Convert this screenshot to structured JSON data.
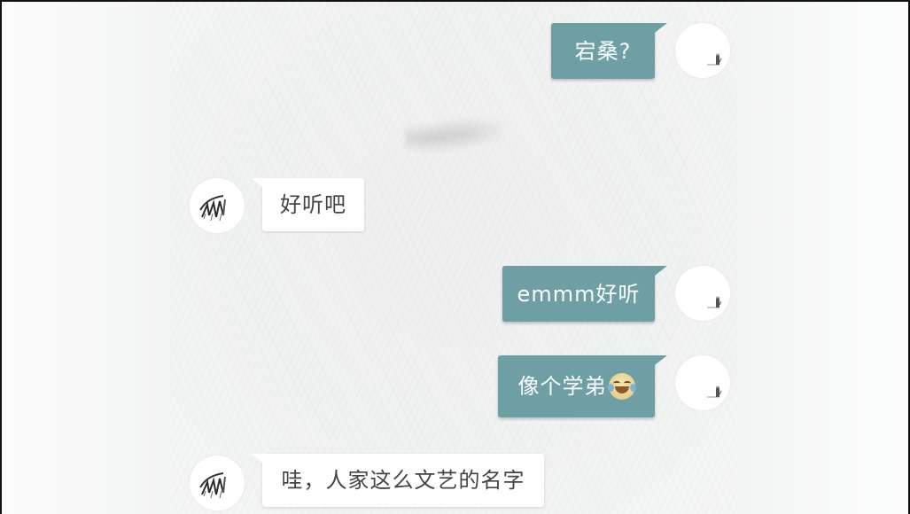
{
  "messages": [
    {
      "sender": "me",
      "text": "宕桑?"
    },
    {
      "sender": "other",
      "text": "好听吧"
    },
    {
      "sender": "me",
      "text": "emmm好听"
    },
    {
      "sender": "me",
      "text": "像个学弟",
      "emoji": "tears-of-joy-emoji"
    },
    {
      "sender": "other",
      "text": "哇，人家这么文艺的名字"
    }
  ],
  "colors": {
    "my_bubble": "#6e9fa5",
    "other_bubble": "#ffffff",
    "background": "#f2f3f3"
  },
  "icons": {
    "my_avatar": "cat-sketch-avatar",
    "other_avatar": "brush-sketch-avatar"
  }
}
